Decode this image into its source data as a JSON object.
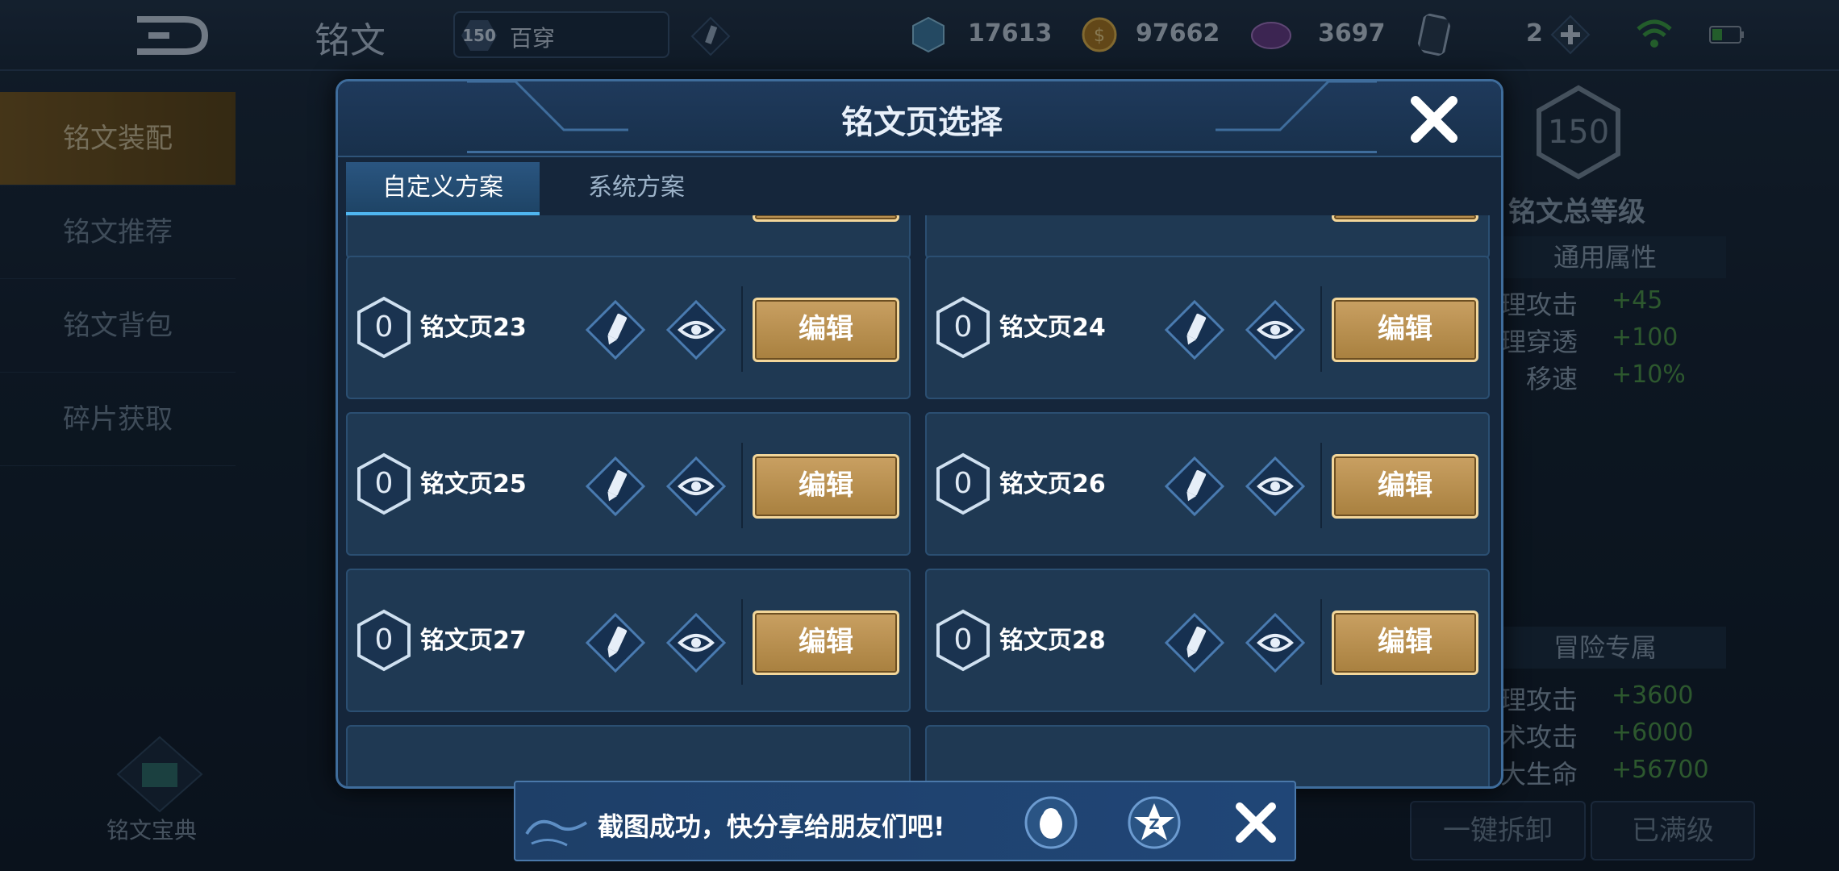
{
  "header": {
    "title": "铭文",
    "rank_level": "150",
    "rank_name": "百穿",
    "currencies": [
      {
        "icon": "blue-crystal-icon",
        "value": "17613"
      },
      {
        "icon": "gold-coin-icon",
        "value": "97662"
      },
      {
        "icon": "purple-gem-icon",
        "value": "3697"
      }
    ],
    "card_count": "2",
    "plus_icon": "plus-icon",
    "wifi_icon": "wifi-icon",
    "battery_icon": "battery-icon"
  },
  "sidebar": {
    "items": [
      {
        "label": "铭文装配",
        "active": true
      },
      {
        "label": "铭文推荐",
        "active": false
      },
      {
        "label": "铭文背包",
        "active": false
      },
      {
        "label": "碎片获取",
        "active": false
      }
    ],
    "codex_label": "铭文宝典"
  },
  "right_panel": {
    "total_level": "150",
    "total_level_label": "铭文总等级",
    "general_title": "通用属性",
    "general_stats": [
      {
        "name": "理攻击",
        "value": "+45"
      },
      {
        "name": "理穿透",
        "value": "+100"
      },
      {
        "name": "移速",
        "value": "+10%"
      }
    ],
    "adventure_title": "冒险专属",
    "adventure_stats": [
      {
        "name": "理攻击",
        "value": "+3600"
      },
      {
        "name": "术攻击",
        "value": "+6000"
      },
      {
        "name": "大生命",
        "value": "+56700"
      }
    ],
    "unequip_label": "一键拆卸",
    "maxed_label": "已满级"
  },
  "modal": {
    "title": "铭文页选择",
    "tabs": [
      {
        "label": "自定义方案",
        "active": true
      },
      {
        "label": "系统方案",
        "active": false
      }
    ],
    "edit_label": "编辑",
    "pages": [
      {
        "name": "铭文页23",
        "level": "0"
      },
      {
        "name": "铭文页24",
        "level": "0"
      },
      {
        "name": "铭文页25",
        "level": "0"
      },
      {
        "name": "铭文页26",
        "level": "0"
      },
      {
        "name": "铭文页27",
        "level": "0"
      },
      {
        "name": "铭文页28",
        "level": "0"
      }
    ]
  },
  "toast": {
    "text": "截图成功，快分享给朋友们吧!",
    "share_icons": [
      "qq-icon",
      "qzone-icon"
    ]
  },
  "colors": {
    "accent_blue": "#3f6d9c",
    "gold_button": "#c9a062",
    "positive_green": "#4f9a4a"
  }
}
